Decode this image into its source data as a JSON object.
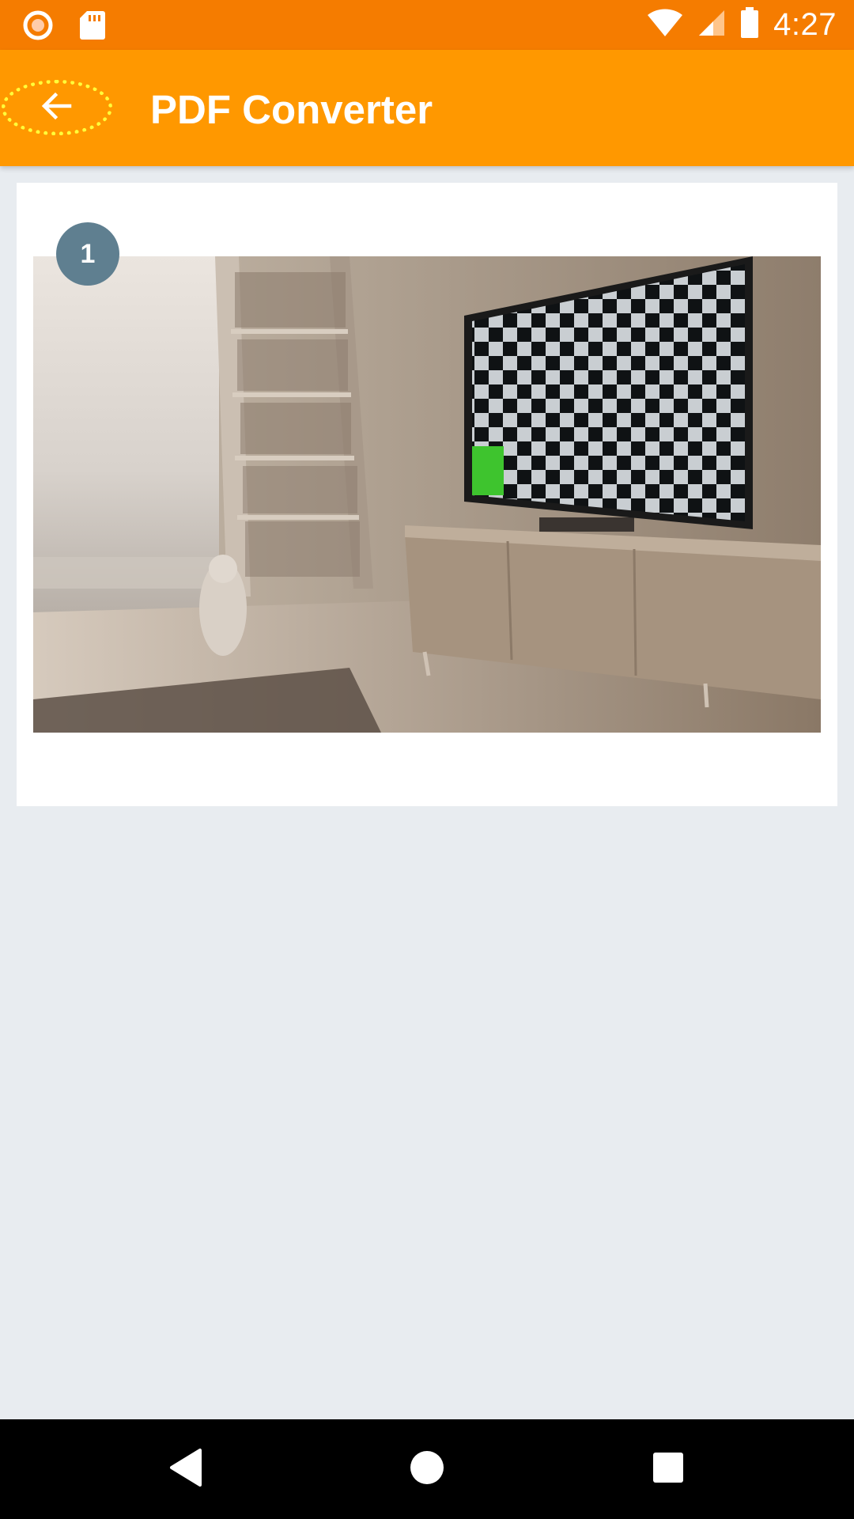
{
  "status_bar": {
    "time": "4:27",
    "icons": [
      "record-icon",
      "sd-card-icon",
      "wifi-icon",
      "cell-signal-icon",
      "battery-icon"
    ]
  },
  "app_bar": {
    "title": "PDF Converter",
    "back_icon": "arrow-back-icon"
  },
  "pages": [
    {
      "number": "1",
      "image_description_icon": "photo-thumbnail"
    }
  ],
  "nav_bar": {
    "icons": [
      "back-triangle-icon",
      "home-circle-icon",
      "recents-square-icon"
    ]
  },
  "colors": {
    "status_bar": "#f57c00",
    "app_bar": "#ff9800",
    "background": "#e8ecf0",
    "badge": "#5f7f90",
    "focus_outline": "#ffff3a"
  }
}
